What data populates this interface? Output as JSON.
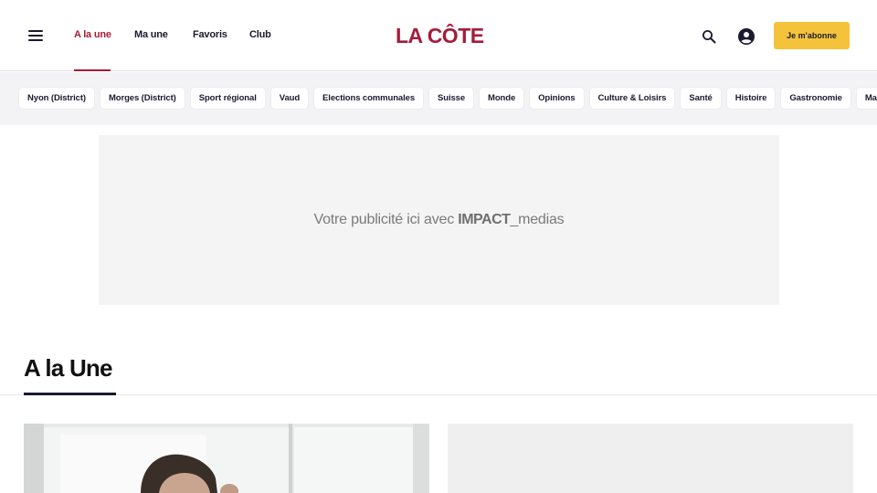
{
  "header": {
    "nav": [
      {
        "label": "A la une",
        "active": true
      },
      {
        "label": "Ma une",
        "active": false
      },
      {
        "label": "Favoris",
        "active": false
      },
      {
        "label": "Club",
        "active": false
      }
    ],
    "logo": "LA CÔTE",
    "subscribe_label": "Je m'abonne",
    "icons": [
      "menu-icon",
      "search-icon",
      "account-icon"
    ]
  },
  "categories": [
    "Nyon (District)",
    "Morges (District)",
    "Sport régional",
    "Vaud",
    "Elections communales",
    "Suisse",
    "Monde",
    "Opinions",
    "Culture & Loisirs",
    "Santé",
    "Histoire",
    "Gastronomie",
    "Magazines"
  ],
  "ad": {
    "text_prefix": "Votre publicité ici avec ",
    "brand_bold": "IMPACT",
    "brand_rest": "_medias"
  },
  "section": {
    "title": "A la Une"
  },
  "colors": {
    "brand": "#a51c3a",
    "subscribe": "#f5c33b",
    "text": "#1a1a2e"
  }
}
